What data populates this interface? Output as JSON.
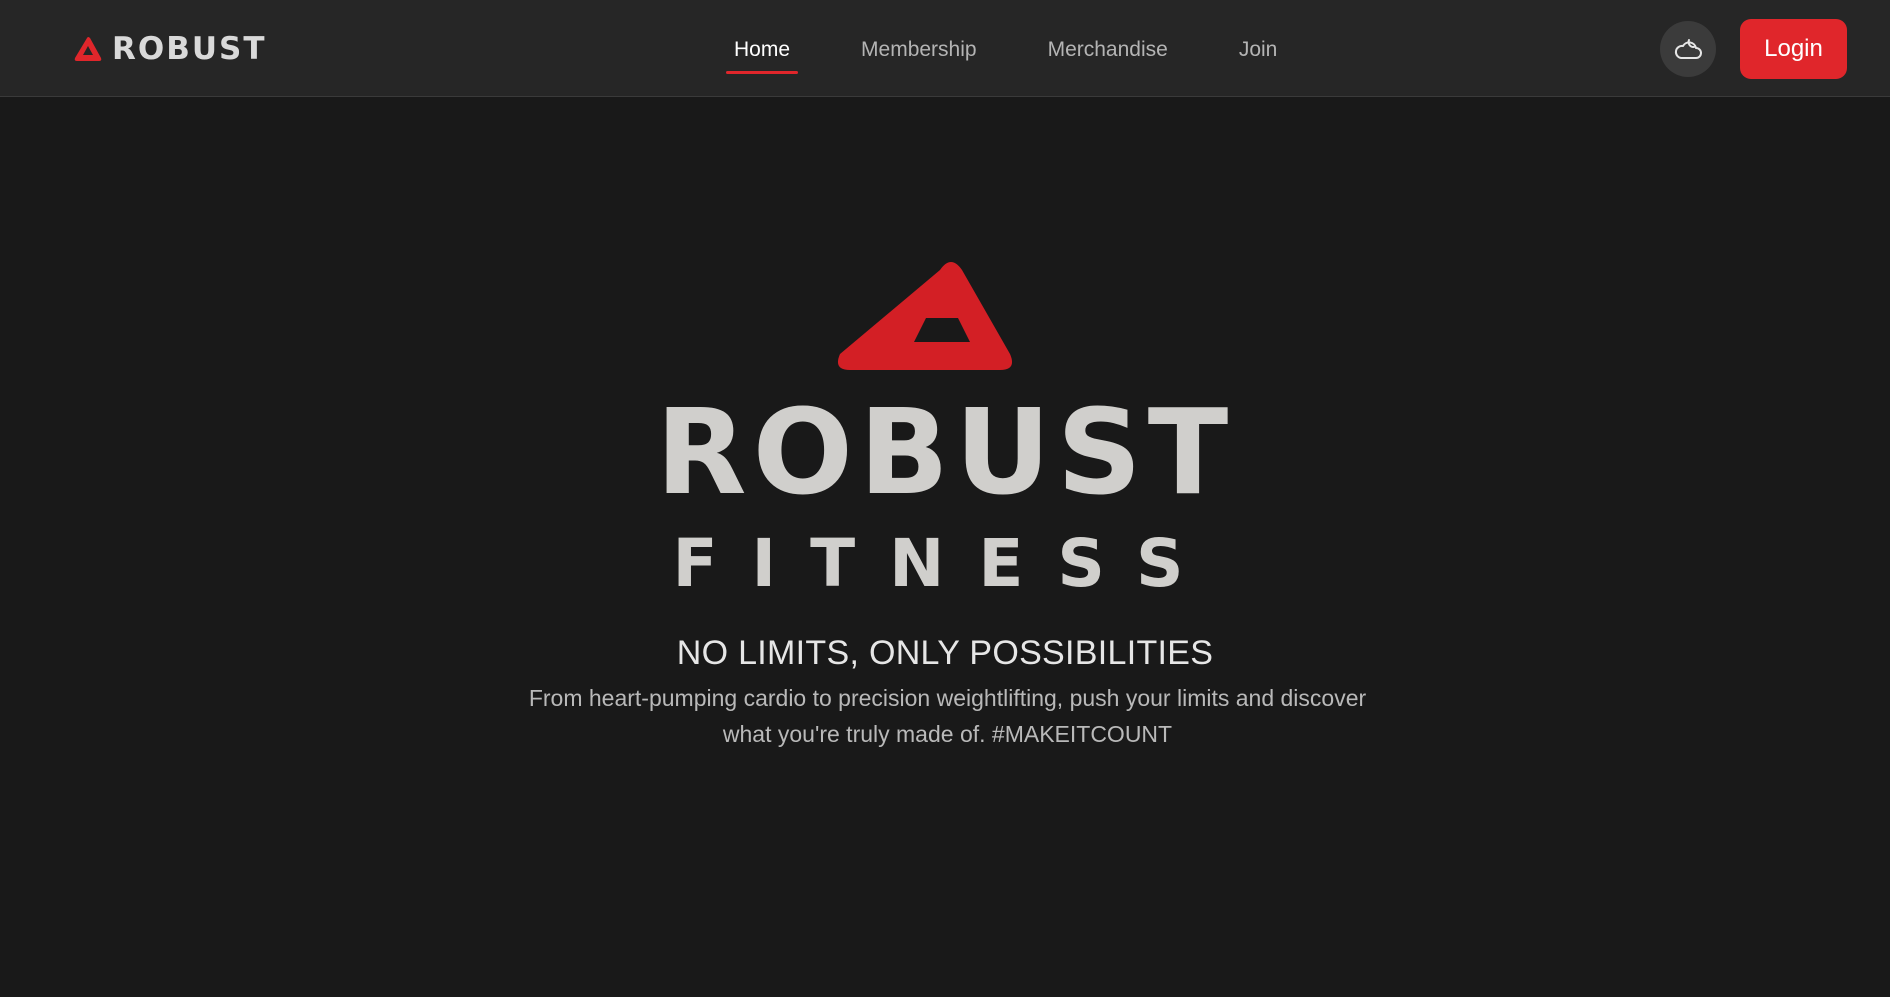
{
  "navbar": {
    "brand": "ROBUST",
    "links": [
      {
        "label": "Home",
        "active": true
      },
      {
        "label": "Membership",
        "active": false
      },
      {
        "label": "Merchandise",
        "active": false
      },
      {
        "label": "Join",
        "active": false
      }
    ],
    "theme_toggle_icon": "cloud-icon",
    "login_label": "Login"
  },
  "hero": {
    "logo_word": "ROBUST",
    "logo_subword": "FITNESS",
    "headline": "NO LIMITS, ONLY POSSIBILITIES",
    "description": "From heart-pumping cardio to precision weightlifting, push your limits and discover what you're truly made of. #MAKEITCOUNT"
  },
  "colors": {
    "background": "#191919",
    "navbar": "#262626",
    "accent": "#e0262b",
    "logo_text": "#d0cfcc"
  }
}
